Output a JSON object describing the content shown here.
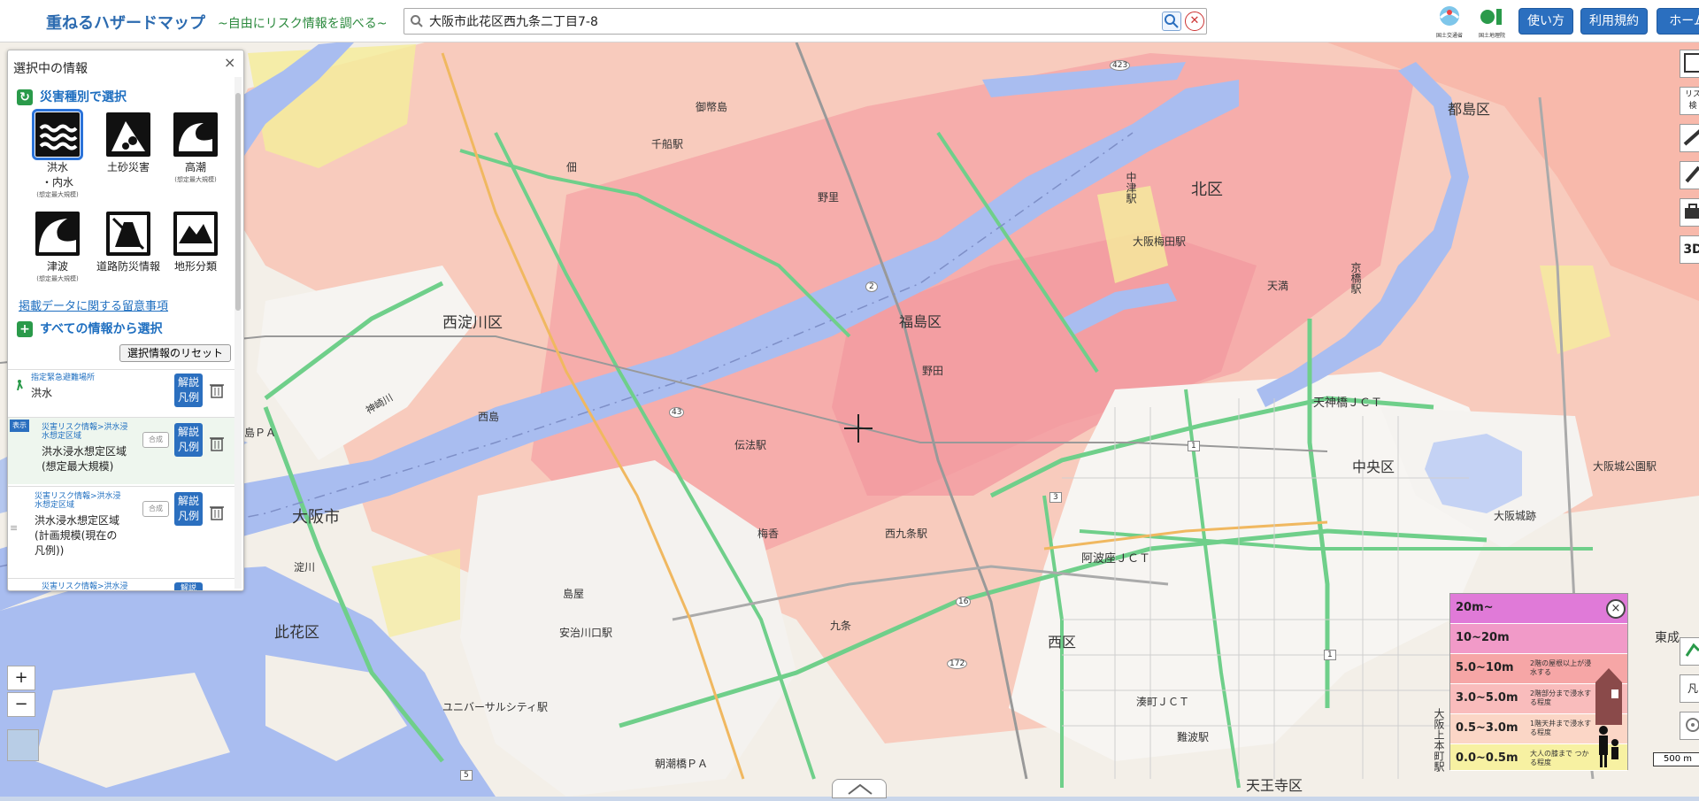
{
  "header": {
    "title": "重ねるハザードマップ",
    "subtitle": "~自由にリスク情報を調べる~",
    "search_value": "大阪市此花区西九条二丁目7-8",
    "buttons": [
      "使い方",
      "利用規約",
      "ホーム"
    ],
    "logo_caption_1": "国土交通省",
    "logo_caption_2": "国土地理院"
  },
  "panel": {
    "title": "選択中の情報",
    "close": "×",
    "section_disaster": "災害種別で選択",
    "hazards": [
      {
        "label": "洪水\n・内水",
        "note": "(想定最大規模)"
      },
      {
        "label": "土砂災害",
        "note": ""
      },
      {
        "label": "高潮",
        "note": "(想定最大規模)"
      },
      {
        "label": "津波",
        "note": "(想定最大規模)"
      },
      {
        "label": "道路防災情報",
        "note": ""
      },
      {
        "label": "地形分類",
        "note": ""
      }
    ],
    "notice_link": "掲載データに関する留意事項",
    "section_all": "すべての情報から選択",
    "reset_label": "選択情報のリセット",
    "layers": [
      {
        "category": "指定緊急避難場所",
        "name": "洪水",
        "kaisetsu": "解説\n凡例"
      },
      {
        "badge": "表示",
        "category": "災害リスク情報>洪水浸\n水想定区域",
        "name": "洪水浸水想定区域\n(想定最大規模)",
        "gosei": "合成",
        "kaisetsu": "解説\n凡例"
      },
      {
        "category": "災害リスク情報>洪水浸\n水想定区域",
        "name": "洪水浸水想定区域\n(計画規模(現在の\n凡例))",
        "gosei": "合成",
        "kaisetsu": "解説\n凡例"
      },
      {
        "category": "災害リスク情報>洪水浸",
        "name": "",
        "kaisetsu": "解説"
      }
    ]
  },
  "zoom": {
    "in": "+",
    "out": "−"
  },
  "legend": {
    "close": "×",
    "rows": [
      {
        "range": "20m~",
        "desc": "",
        "color": "#e07ad8"
      },
      {
        "range": "10~20m",
        "desc": "",
        "color": "#f19ac8"
      },
      {
        "range": "5.0~10m",
        "desc": "2階の屋根以上が浸水する",
        "color": "#f6a6a6"
      },
      {
        "range": "3.0~5.0m",
        "desc": "2階部分まで浸水する程度",
        "color": "#f9bcbc"
      },
      {
        "range": "0.5~3.0m",
        "desc": "1階天井まで浸水する程度",
        "color": "#fbd6c6"
      },
      {
        "range": "0.0~0.5m",
        "desc": "大人の膝まで つかる程度",
        "color": "#f7f1a2"
      }
    ]
  },
  "right_tools": [
    "リス 検",
    "凡"
  ],
  "scale_label": "500 m",
  "map_labels": [
    {
      "text": "千船駅",
      "size": 12
    },
    {
      "text": "佃",
      "size": 12
    },
    {
      "text": "御幣島",
      "size": 12
    },
    {
      "text": "野里",
      "size": 12
    },
    {
      "text": "北区",
      "size": 18
    },
    {
      "text": "都島区",
      "size": 16
    },
    {
      "text": "大阪梅田駅",
      "size": 12
    },
    {
      "text": "西淀川区",
      "size": 17
    },
    {
      "text": "福島区",
      "size": 16
    },
    {
      "text": "天神橋ＪＣＴ",
      "size": 13
    },
    {
      "text": "伝法駅",
      "size": 12
    },
    {
      "text": "中央区",
      "size": 16
    },
    {
      "text": "大阪城公園駅",
      "size": 12
    },
    {
      "text": "大阪城跡",
      "size": 12
    },
    {
      "text": "大阪市",
      "size": 18
    },
    {
      "text": "梅香",
      "size": 12
    },
    {
      "text": "西九条駅",
      "size": 12
    },
    {
      "text": "阿波座ＪＣＴ",
      "size": 13
    },
    {
      "text": "淀川",
      "size": 12
    },
    {
      "text": "島屋",
      "size": 12
    },
    {
      "text": "安治川口駅",
      "size": 12
    },
    {
      "text": "九条",
      "size": 12
    },
    {
      "text": "西区",
      "size": 16
    },
    {
      "text": "此花区",
      "size": 17
    },
    {
      "text": "ユニバーサルシティ駅",
      "size": 12
    },
    {
      "text": "湊町ＪＣＴ",
      "size": 12
    },
    {
      "text": "難波駅",
      "size": 12
    },
    {
      "text": "大阪上本町駅",
      "size": 12
    },
    {
      "text": "朝潮橋ＰＡ",
      "size": 12
    },
    {
      "text": "天王寺区",
      "size": 16
    },
    {
      "text": "東成",
      "size": 14
    },
    {
      "text": "西島",
      "size": 12
    },
    {
      "text": "神崎川",
      "size": 11
    },
    {
      "text": "島ＰＡ",
      "size": 12
    },
    {
      "text": "野田",
      "size": 12
    },
    {
      "text": "天満",
      "size": 12
    },
    {
      "text": "中津駅",
      "size": 12
    },
    {
      "text": "京橋駅",
      "size": 12
    }
  ],
  "route_numbers": [
    "423",
    "2",
    "43",
    "1",
    "3",
    "16",
    "172",
    "1",
    "5"
  ]
}
